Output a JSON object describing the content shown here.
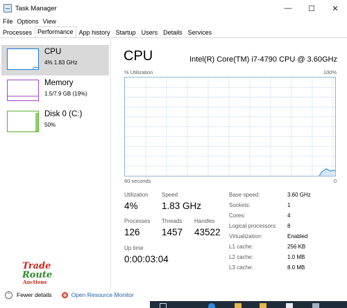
{
  "window": {
    "title": "Task Manager"
  },
  "menu": [
    "File",
    "Options",
    "View"
  ],
  "tabs": [
    "Processes",
    "Performance",
    "App history",
    "Startup",
    "Users",
    "Details",
    "Services"
  ],
  "active_tab": "Performance",
  "resources": [
    {
      "title": "CPU",
      "sub": "4%  1.83 GHz",
      "color": "#1a7ad6",
      "active": true
    },
    {
      "title": "Memory",
      "sub": "1.5/7.9 GB (19%)",
      "color": "#a443c2",
      "active": false
    },
    {
      "title": "Disk 0 (C:)",
      "sub": "50%",
      "color": "#58b02c",
      "active": false
    }
  ],
  "detail": {
    "title": "CPU",
    "model": "Intel(R) Core(TM) i7-4790 CPU @ 3.60GHz",
    "graph_label": "% Utilization",
    "graph_max": "100%",
    "axis_left": "60 seconds",
    "axis_right": "0",
    "graph_color": "#1a7ad6",
    "utilization_label": "Utilization",
    "utilization": "4%",
    "speed_label": "Speed",
    "speed": "1.83 GHz",
    "processes_label": "Processes",
    "processes": "126",
    "threads_label": "Threads",
    "threads": "1457",
    "handles_label": "Handles",
    "handles": "43522",
    "uptime_label": "Up time",
    "uptime": "0:00:03:04",
    "specs": [
      {
        "label": "Base speed:",
        "value": "3.60 GHz"
      },
      {
        "label": "Sockets:",
        "value": "1"
      },
      {
        "label": "Cores:",
        "value": "4"
      },
      {
        "label": "Logical processors:",
        "value": "8"
      },
      {
        "label": "Virtualization:",
        "value": "Enabled"
      },
      {
        "label": "L1 cache:",
        "value": "256 KB"
      },
      {
        "label": "L2 cache:",
        "value": "1.0 MB"
      },
      {
        "label": "L3 cache:",
        "value": "8.0 MB"
      }
    ]
  },
  "watermark": {
    "line1": "Trade",
    "line2": "Route",
    "line3": "Auctions"
  },
  "footer": {
    "fewer_details": "Fewer details",
    "resource_monitor": "Open Resource Monitor"
  }
}
